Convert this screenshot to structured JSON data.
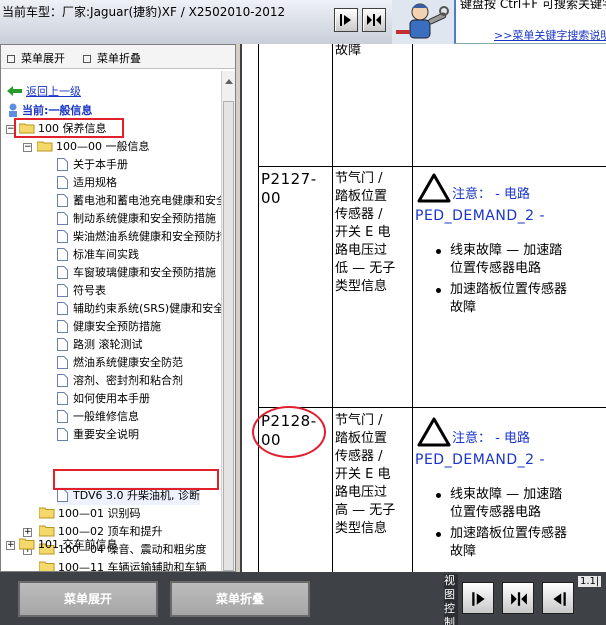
{
  "header": {
    "vehicle_title": "当前车型：厂家:Jaguar(捷豹)XF / X2502010-2012",
    "tip_text": "键盘按   Ctrl+F   可搜索关键字！",
    "tip_link": ">>菜单关键字搜索说明"
  },
  "tree_toolbar": {
    "expand_label": "菜单展开",
    "collapse_label": "菜单折叠"
  },
  "tree": {
    "back_label": "返回上一级",
    "current_label": "当前:一般信息",
    "root_label": "100 保养信息",
    "sub_label": "100—00 一般信息",
    "docs": [
      "关于本手册",
      "适用规格",
      "蓄电池和蓄电池充电健康和安全",
      "制动系统健康和安全预防措施",
      "柴油燃油系统健康和安全预防措施",
      "标准车间实践",
      "车窗玻璃健康和安全预防措施",
      "符号表",
      "辅助约束系统(SRS)健康和安全",
      "健康安全预防措施",
      "路测 滚轮测试",
      "燃油系统健康安全防范",
      "溶剂、密封剂和粘合剂",
      "如何使用本手册",
      "一般维修信息",
      "重要安全说明"
    ],
    "selected_doc": "TDV6 3.0 升柴油机, 诊断",
    "items": [
      "100—01 识别码",
      "100—02 顶车和提升",
      "100—04 噪音、震动和粗劣度",
      "100—11 车辆运输辅助和车辆",
      "101 交车前信息"
    ]
  },
  "content": {
    "top_desc": "故障",
    "rows": [
      {
        "code_line1": "P2127-",
        "code_line2": "00",
        "desc": [
          "节气门 /",
          "踏板位置",
          "传感器 /",
          "开关 E 电",
          "路电压过",
          "低 — 无子",
          "类型信息"
        ],
        "notice": "注意：  - 电路",
        "pedal": "PED_DEMAND_2 -",
        "bullet1": [
          "线束故障 — 加速踏",
          "位置传感器电路"
        ],
        "bullet2": [
          "加速踏板位置传感器",
          "故障"
        ]
      },
      {
        "code_line1": "P2128-",
        "code_line2": "00",
        "desc": [
          "节气门 /",
          "踏板位置",
          "传感器 /",
          "开关 E 电",
          "路电压过",
          "高 — 无子",
          "类型信息"
        ],
        "notice": "注意：  - 电路",
        "pedal": "PED_DEMAND_2 -",
        "bullet1": [
          "线束故障 — 加速踏",
          "位置传感器电路"
        ],
        "bullet2": [
          "加速踏板位置传感器",
          "故障"
        ]
      }
    ]
  },
  "bottom": {
    "expand_label": "菜单展开",
    "collapse_label": "菜单折叠",
    "view_label": "视图控制",
    "zoom": "1.1|"
  },
  "colors": {
    "link_blue": "#1a35c8",
    "highlight_red": "#e0202a",
    "bottom_bar": "#3e4247"
  }
}
